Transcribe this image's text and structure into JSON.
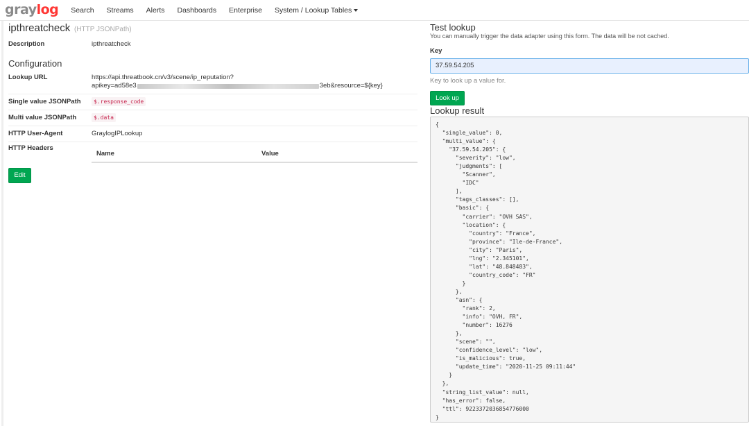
{
  "navbar": {
    "logo_gray": "gray",
    "logo_log": "log",
    "items": [
      {
        "label": "Search"
      },
      {
        "label": "Streams"
      },
      {
        "label": "Alerts"
      },
      {
        "label": "Dashboards"
      },
      {
        "label": "Enterprise"
      },
      {
        "label": "System / Lookup Tables"
      }
    ]
  },
  "adapter": {
    "name": "ipthreatcheck",
    "type": "(HTTP JSONPath)",
    "description_label": "Description",
    "description_value": "ipthreatcheck"
  },
  "configuration": {
    "heading": "Configuration",
    "lookup_url_label": "Lookup URL",
    "lookup_url_line1": "https://api.threatbook.cn/v3/scene/ip_reputation?",
    "lookup_url_line2_start": "apikey=ad58e3",
    "lookup_url_line2_end": "3eb&resource=${key}",
    "single_value_label": "Single value JSONPath",
    "single_value": "$.response_code",
    "multi_value_label": "Multi value JSONPath",
    "multi_value": "$.data",
    "user_agent_label": "HTTP User-Agent",
    "user_agent_value": "GraylogIPLookup",
    "headers_label": "HTTP Headers",
    "headers_col_name": "Name",
    "headers_col_value": "Value",
    "edit_button": "Edit"
  },
  "test_lookup": {
    "title": "Test lookup",
    "help": "You can manually trigger the data adapter using this form. The data will be not cached.",
    "key_label": "Key",
    "key_value": "37.59.54.205",
    "key_help": "Key to look up a value for.",
    "button": "Look up",
    "result_title": "Lookup result",
    "result": "{\n  \"single_value\": 0,\n  \"multi_value\": {\n    \"37.59.54.205\": {\n      \"severity\": \"low\",\n      \"judgments\": [\n        \"Scanner\",\n        \"IDC\"\n      ],\n      \"tags_classes\": [],\n      \"basic\": {\n        \"carrier\": \"OVH SAS\",\n        \"location\": {\n          \"country\": \"France\",\n          \"province\": \"Ile-de-France\",\n          \"city\": \"Paris\",\n          \"lng\": \"2.345101\",\n          \"lat\": \"48.848483\",\n          \"country_code\": \"FR\"\n        }\n      },\n      \"asn\": {\n        \"rank\": 2,\n        \"info\": \"OVH, FR\",\n        \"number\": 16276\n      },\n      \"scene\": \"\",\n      \"confidence_level\": \"low\",\n      \"is_malicious\": true,\n      \"update_time\": \"2020-11-25 09:11:44\"\n    }\n  },\n  \"string_list_value\": null,\n  \"has_error\": false,\n  \"ttl\": 9223372036854776000\n}"
  },
  "colors": {
    "brand_red": "#ff3633",
    "success_green": "#00a651",
    "code_red": "#c7254e"
  }
}
